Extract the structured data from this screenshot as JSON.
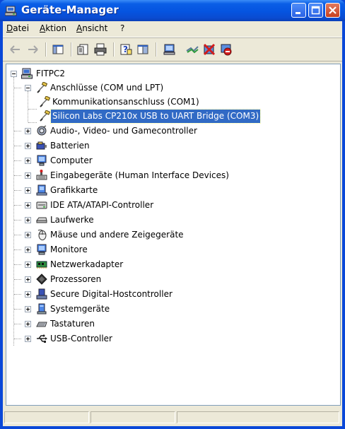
{
  "window": {
    "title": "Geräte-Manager"
  },
  "menubar": {
    "items": [
      "Datei",
      "Aktion",
      "Ansicht",
      "?"
    ]
  },
  "toolbar": {
    "buttons": [
      "back-icon",
      "forward-icon",
      "show-hide-tree-icon",
      "properties-icon",
      "print-icon",
      "help-icon",
      "view-icon",
      "scan-hardware-icon",
      "update-driver-icon",
      "uninstall-icon",
      "disable-icon"
    ]
  },
  "tree": {
    "root": "FITPC2",
    "ports_category": "Anschlüsse (COM und LPT)",
    "ports_children": [
      "Kommunikationsanschluss (COM1)",
      "Silicon Labs CP210x USB to UART Bridge (COM3)"
    ],
    "categories": [
      "Audio-, Video- und Gamecontroller",
      "Batterien",
      "Computer",
      "Eingabegeräte (Human Interface Devices)",
      "Grafikkarte",
      "IDE ATA/ATAPI-Controller",
      "Laufwerke",
      "Mäuse und andere Zeigegeräte",
      "Monitore",
      "Netzwerkadapter",
      "Prozessoren",
      "Secure Digital-Hostcontroller",
      "Systemgeräte",
      "Tastaturen",
      "USB-Controller"
    ]
  },
  "colors": {
    "title_bar": "#0554e0",
    "selection": "#316ac5",
    "face": "#ece9d8",
    "close_button": "#c8401e"
  }
}
